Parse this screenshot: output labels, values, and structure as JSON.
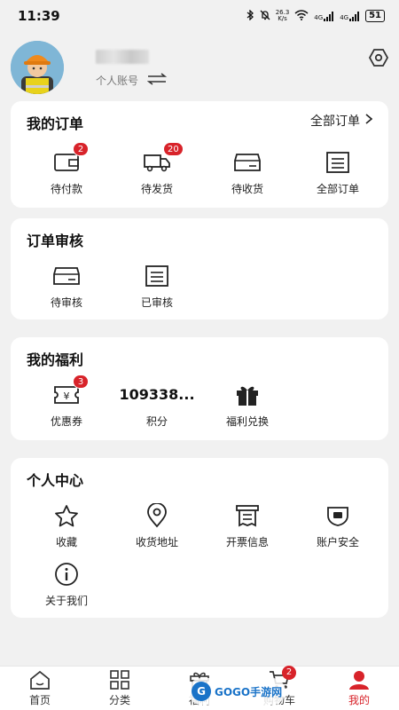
{
  "status_bar": {
    "time": "11:39",
    "net_speed_value": "26.3",
    "net_speed_unit": "K/s",
    "signal_1": "4G",
    "signal_2": "4G",
    "battery": "51"
  },
  "profile": {
    "account_label": "个人账号"
  },
  "my_orders": {
    "title": "我的订单",
    "all_link": "全部订单",
    "items": [
      {
        "label": "待付款",
        "badge": "2",
        "icon": "wallet-icon"
      },
      {
        "label": "待发货",
        "badge": "20",
        "icon": "truck-icon"
      },
      {
        "label": "待收货",
        "badge": "",
        "icon": "box-icon"
      },
      {
        "label": "全部订单",
        "badge": "",
        "icon": "list-icon"
      }
    ]
  },
  "order_review": {
    "title": "订单审核",
    "items": [
      {
        "label": "待审核",
        "icon": "box-icon"
      },
      {
        "label": "已审核",
        "icon": "list-icon"
      }
    ]
  },
  "my_benefits": {
    "title": "我的福利",
    "coupon_label": "优惠券",
    "coupon_badge": "3",
    "points_value": "109338...",
    "points_label": "积分",
    "exchange_label": "福利兑换"
  },
  "personal_center": {
    "title": "个人中心",
    "items": [
      {
        "label": "收藏",
        "icon": "star-icon"
      },
      {
        "label": "收货地址",
        "icon": "location-icon"
      },
      {
        "label": "开票信息",
        "icon": "invoice-icon"
      },
      {
        "label": "账户安全",
        "icon": "shield-icon"
      },
      {
        "label": "关于我们",
        "icon": "info-icon"
      }
    ]
  },
  "tab_bar": {
    "home": "首页",
    "category": "分类",
    "benefits": "福利",
    "cart": "购物车",
    "cart_badge": "2",
    "mine": "我的"
  },
  "watermark": {
    "text": "GOGO手游网"
  },
  "colors": {
    "accent": "#d8232a",
    "background": "#f1f1f1",
    "card": "#ffffff"
  }
}
